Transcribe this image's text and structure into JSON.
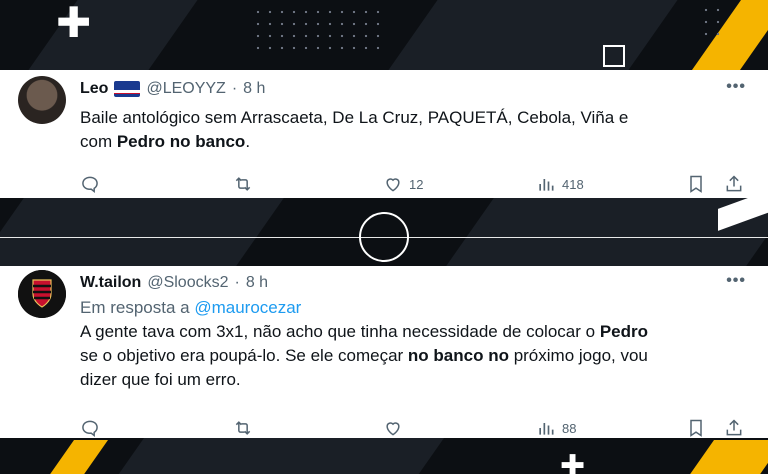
{
  "tweets": [
    {
      "name": "Leo",
      "handle": "@LEOYYZ",
      "time": "8 h",
      "text": {
        "line1": "Baile antológico sem Arrascaeta, De La Cruz, PAQUETÁ, Cebola, Viña e",
        "pre": "com ",
        "bold": "Pedro no banco",
        "post": "."
      },
      "likes": "12",
      "views": "418"
    },
    {
      "name": "W.tailon",
      "handle": "@Sloocks2",
      "time": "8 h",
      "reply_prefix": "Em resposta a ",
      "reply_to": "@maurocezar",
      "text": {
        "p1": "A gente tava com 3x1, não acho que tinha necessidade de colocar o ",
        "b1": "Pedro",
        "p2": "se o objetivo era poupá-lo. Se ele começar ",
        "b2": "no banco no",
        "p3": " próximo jogo, vou",
        "p4": "dizer que foi um erro."
      },
      "views": "88"
    }
  ],
  "colors": {
    "accent": "#f5b400",
    "link": "#1d9bf0",
    "muted": "#536471"
  },
  "icons": [
    "plus-icon",
    "square-outline-icon",
    "center-circle-icon",
    "flag-icon",
    "more-icon",
    "reply-icon",
    "retweet-icon",
    "like-icon",
    "views-icon",
    "bookmark-icon",
    "share-icon"
  ]
}
